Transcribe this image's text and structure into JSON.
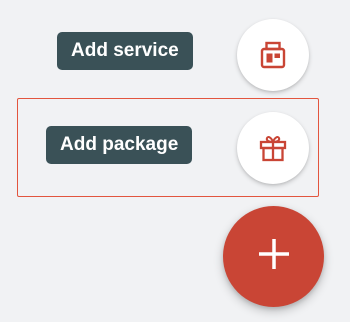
{
  "speed_dial": {
    "actions": [
      {
        "label": "Add service",
        "icon": "service-box-icon"
      },
      {
        "label": "Add package",
        "icon": "gift-icon"
      }
    ],
    "main_button": {
      "icon": "plus-icon"
    },
    "colors": {
      "label_background": "#3a5157",
      "icon_red": "#c94535",
      "focus_outline": "#e2553e",
      "background": "#f1f2f4"
    }
  }
}
